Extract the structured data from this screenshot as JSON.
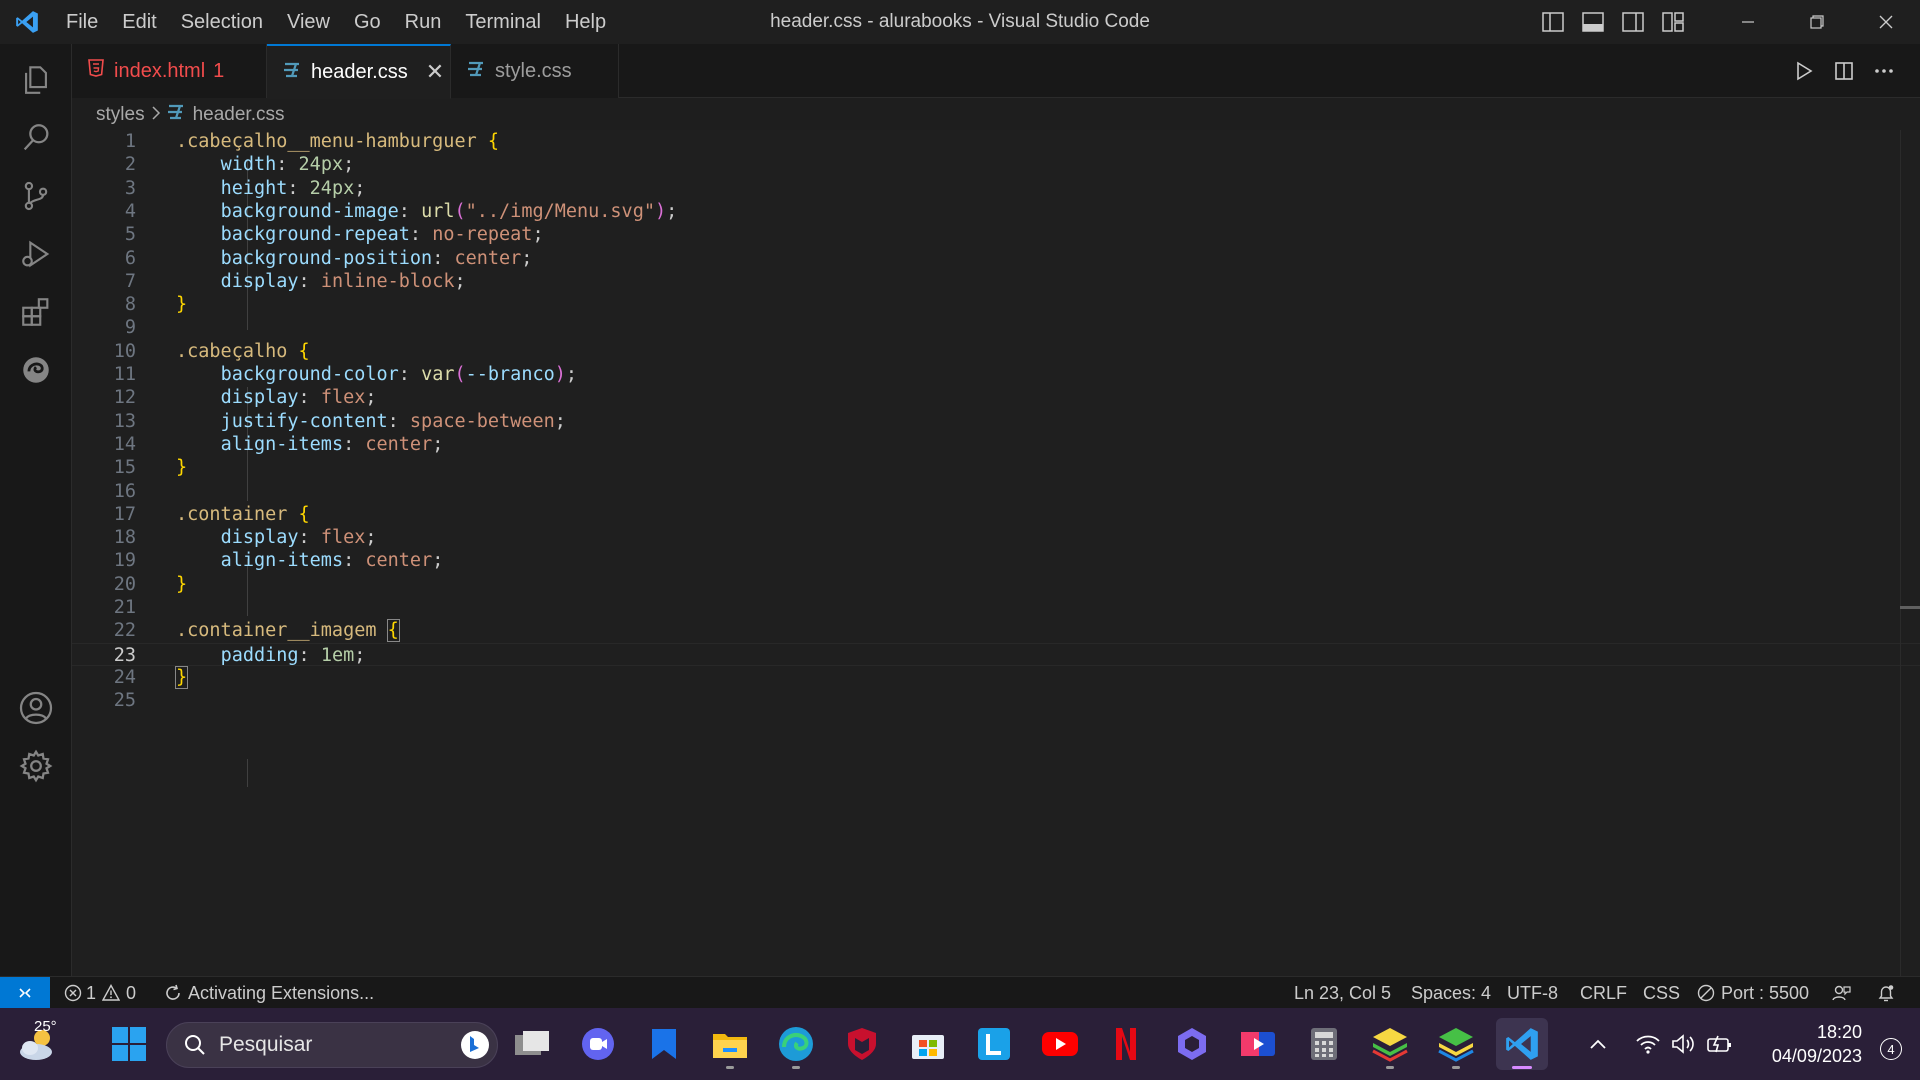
{
  "window": {
    "title": "header.css - alurabooks - Visual Studio Code",
    "menu": [
      "File",
      "Edit",
      "Selection",
      "View",
      "Go",
      "Run",
      "Terminal",
      "Help"
    ]
  },
  "tabs": [
    {
      "label": "index.html",
      "badge": "1",
      "icon": "html-file-icon",
      "color": "#f14c4c",
      "active": false
    },
    {
      "label": "header.css",
      "icon": "css-file-icon",
      "color": "#ffffff",
      "active": true,
      "close": "✕"
    },
    {
      "label": "style.css",
      "icon": "css-file-icon",
      "color": "#cccccc",
      "active": false
    }
  ],
  "breadcrumb": {
    "folder": "styles",
    "file": "header.css"
  },
  "editor": {
    "current_line": 23,
    "lines": [
      ".cabeçalho__menu-hamburguer {",
      "    width: 24px;",
      "    height: 24px;",
      "    background-image: url(\"../img/Menu.svg\");",
      "    background-repeat: no-repeat;",
      "    background-position: center;",
      "    display: inline-block;",
      "}",
      "",
      ".cabeçalho {",
      "    background-color: var(--branco);",
      "    display: flex;",
      "    justify-content: space-between;",
      "    align-items: center;",
      "}",
      "",
      ".container {",
      "    display: flex;",
      "    align-items: center;",
      "}",
      "",
      ".container__imagem {",
      "    padding: 1em;",
      "}",
      ""
    ]
  },
  "statusbar": {
    "errors": "1",
    "warnings": "0",
    "activity": "Activating Extensions...",
    "position": "Ln 23, Col 5",
    "spaces": "Spaces: 4",
    "encoding": "UTF-8",
    "eol": "CRLF",
    "language": "CSS",
    "port": "Port : 5500"
  },
  "taskbar": {
    "weather_temp": "25°",
    "search_placeholder": "Pesquisar",
    "time": "18:20",
    "date": "04/09/2023",
    "notification_count": "4"
  },
  "colors": {
    "accent": "#0078d4",
    "selector": "#d7ba7d",
    "property": "#9cdcfe",
    "value": "#ce9178",
    "number": "#b5cea8",
    "brace": "#ffd700"
  }
}
